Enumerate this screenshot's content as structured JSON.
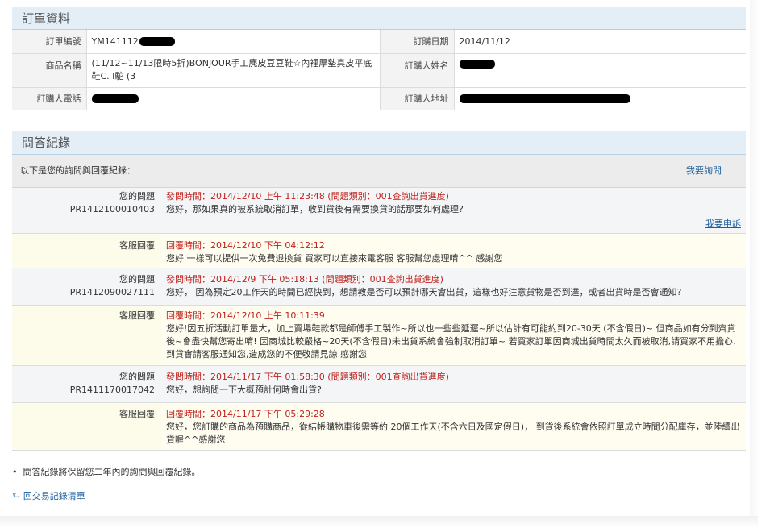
{
  "order_section": {
    "title": "訂單資料",
    "rows": [
      {
        "k1": "訂單編號",
        "v1": "YM141112",
        "k2": "訂購日期",
        "v2": "2014/11/12"
      },
      {
        "k1": "商品名稱",
        "v1": "(11/12~11/13限時5折)BONJOUR手工麂皮豆豆鞋☆內裡厚墊真皮平底鞋C. I駝 (3",
        "k2": "訂購人姓名",
        "v2": ""
      },
      {
        "k1": "訂購人電話",
        "v1": "",
        "k2": "訂購人地址",
        "v2": ""
      }
    ]
  },
  "qa_section": {
    "title": "問答紀錄",
    "intro": "以下是您的詢問與回覆紀錄：",
    "ask_link": "我要詢問",
    "appeal_link": "我要申訴",
    "entries": [
      {
        "label": "您的問題",
        "id": "PR1412100010403",
        "time": "發問時間：2014/12/10 上午 11:23:48 (問題類別：001查詢出貨進度)",
        "text": "您好，那如果真的被系統取消訂單，收到貨後有需要換貨的話那要如何處理?"
      },
      {
        "label": "客服回覆",
        "time": "回覆時間：2014/12/10 下午 04:12:12",
        "text": "您好 一樣可以提供一次免費退換貨 買家可以直接來電客服 客服幫您處理唷^^ 感謝您"
      },
      {
        "label": "您的問題",
        "id": "PR1412090027111",
        "time": "發問時間：2014/12/9 下午 05:18:13 (問題類別：001查詢出貨進度)",
        "text": "您好， 因為預定20工作天的時間已經快到，想請教是否可以預計哪天會出貨，這樣也好注意貨物是否到達，或者出貨時是否會通知?"
      },
      {
        "label": "客服回覆",
        "time": "回覆時間：2014/12/10 上午 10:11:39",
        "text": "您好!因五折活動訂單量大，加上賣場鞋款都是師傅手工製作~所以也一些些延遲~所以估計有可能約到20-30天 (不含假日)~ 但商品如有分到齊貨後~會盡快幫您寄出唷! 因商城比較嚴格~20天(不含假日)未出貨系統會強制取消訂單~ 若買家訂單因商城出貨時間太久而被取消,請買家不用擔心,到貨會請客服通知您,造成您的不便敬請見諒 感謝您"
      },
      {
        "label": "您的問題",
        "id": "PR1411170017042",
        "time": "發問時間：2014/11/17 下午 01:58:30 (問題類別：001查詢出貨進度)",
        "text": "您好，想詢問一下大概預計何時會出貨?"
      },
      {
        "label": "客服回覆",
        "time": "回覆時間：2014/11/17 下午 05:29:28",
        "text": "您好，您訂購的商品為預購商品，從結帳購物車後需等約 20個工作天(不含六日及國定假日)， 到貨後系統會依照訂單成立時間分配庫存，並陸續出貨喔^^感謝您"
      }
    ]
  },
  "footer": {
    "note": "問答紀錄將保留您二年內的詢問與回覆紀錄。",
    "back_link": "回交易記錄清單",
    "back_icon": "return-arrow-icon"
  },
  "colors": {
    "header_bg": "#e4eef6",
    "question_time": "#c0201a",
    "link": "#1a5c9c",
    "answer_bg": "#fffdf0"
  }
}
